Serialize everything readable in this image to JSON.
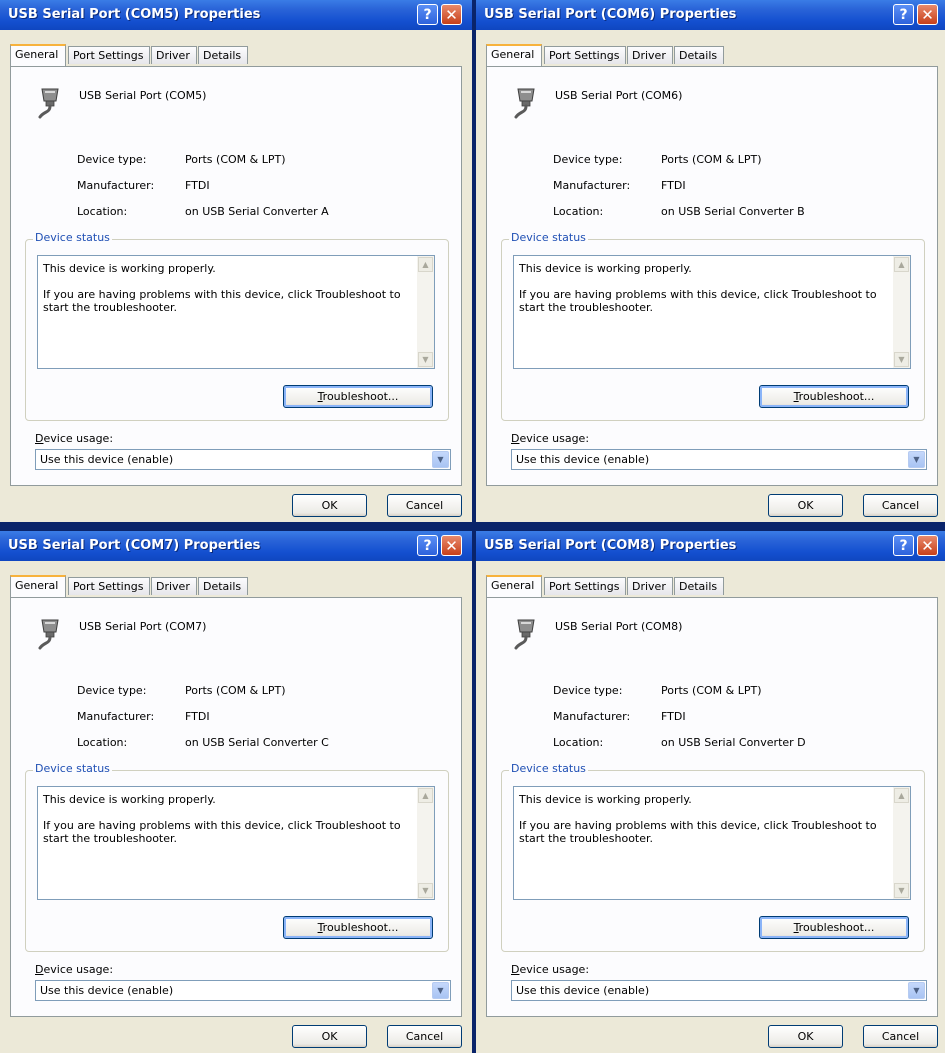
{
  "common": {
    "tabs": [
      "General",
      "Port Settings",
      "Driver",
      "Details"
    ],
    "labels": {
      "device_type": "Device type:",
      "manufacturer": "Manufacturer:",
      "location": "Location:"
    },
    "status_caption": "Device status",
    "status_line1": "This device is working properly.",
    "status_line2": "If you are having problems with this device, click Troubleshoot to start the troubleshooter.",
    "troubleshoot_rest": "roubleshoot...",
    "troubleshoot_key": "T",
    "usage_key": "D",
    "usage_rest": "evice usage:",
    "usage_value": "Use this device (enable)",
    "ok_label": "OK",
    "cancel_label": "Cancel",
    "help_glyph": "?",
    "close_glyph": "✕"
  },
  "windows": [
    {
      "title": "USB Serial Port (COM5) Properties",
      "device_name": "USB Serial Port (COM5)",
      "device_type": "Ports (COM & LPT)",
      "manufacturer": "FTDI",
      "location": "on USB Serial Converter A"
    },
    {
      "title": "USB Serial Port (COM6) Properties",
      "device_name": "USB Serial Port (COM6)",
      "device_type": "Ports (COM & LPT)",
      "manufacturer": "FTDI",
      "location": "on USB Serial Converter B"
    },
    {
      "title": "USB Serial Port (COM7) Properties",
      "device_name": "USB Serial Port (COM7)",
      "device_type": "Ports (COM & LPT)",
      "manufacturer": "FTDI",
      "location": "on USB Serial Converter C"
    },
    {
      "title": "USB Serial Port (COM8) Properties",
      "device_name": "USB Serial Port (COM8)",
      "device_type": "Ports (COM & LPT)",
      "manufacturer": "FTDI",
      "location": "on USB Serial Converter D"
    }
  ]
}
